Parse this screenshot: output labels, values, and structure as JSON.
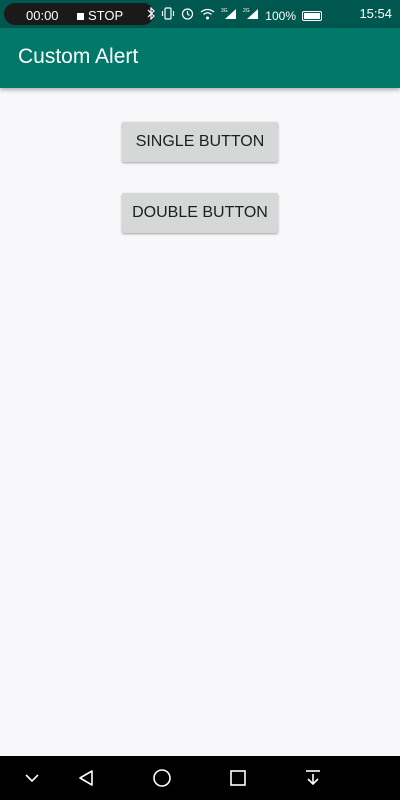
{
  "status_bar": {
    "recorder_time": "00:00",
    "recorder_stop_label": "STOP",
    "battery_percent": "100%",
    "clock": "15:54",
    "icons": [
      "bluetooth-icon",
      "vibrate-icon",
      "alarm-icon",
      "wifi-icon",
      "signal-3g-icon",
      "signal-2g-icon",
      "battery-icon"
    ]
  },
  "app_bar": {
    "title": "Custom Alert",
    "color": "#00796b"
  },
  "main": {
    "single_button_label": "SINGLE BUTTON",
    "double_button_label": "DOUBLE BUTTON"
  },
  "nav_bar": {
    "buttons": [
      "collapse-icon",
      "back-icon",
      "home-icon",
      "recents-icon",
      "notification-pull-icon"
    ]
  }
}
